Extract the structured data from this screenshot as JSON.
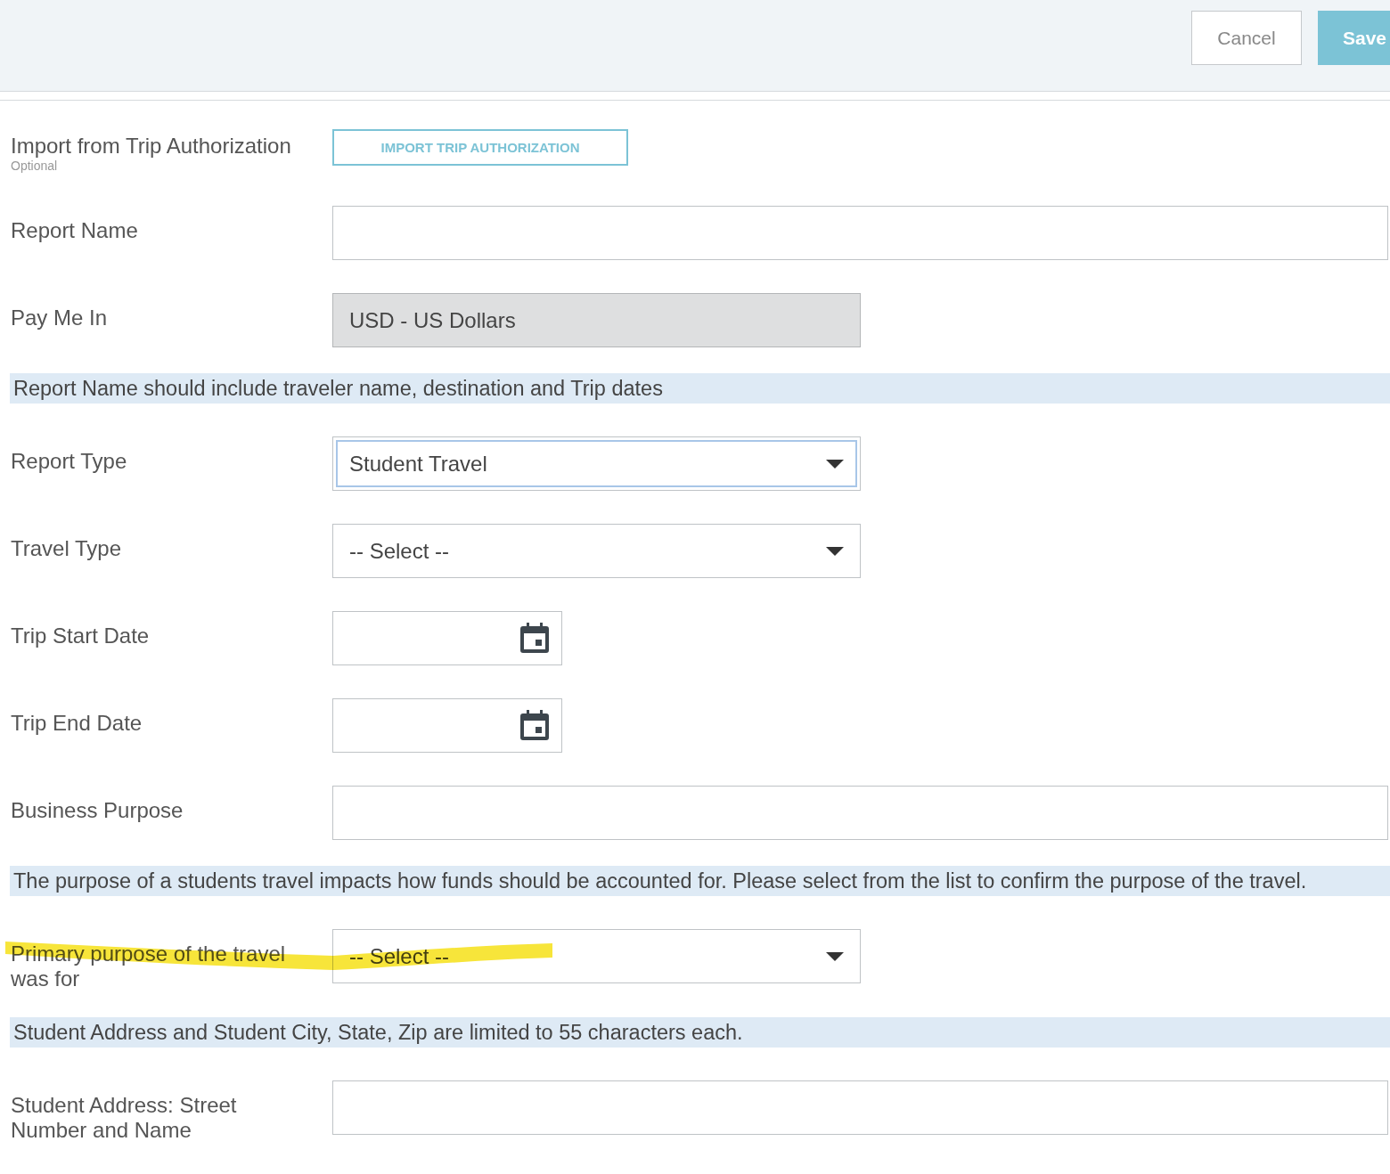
{
  "header": {
    "buttons": [
      {
        "label": "Cancel",
        "kind": "secondary"
      },
      {
        "label": "Save",
        "kind": "primary"
      }
    ]
  },
  "rows": [
    {
      "kind": "button",
      "label": "Import from Trip Authorization",
      "hint": "Optional",
      "button": "IMPORT TRIP AUTHORIZATION"
    },
    {
      "kind": "text",
      "label": "Report Name"
    },
    {
      "kind": "readonly",
      "label": "Pay Me In",
      "value": "USD - US Dollars"
    },
    {
      "kind": "note",
      "text": "Report Name should include traveler name, destination and Trip dates"
    },
    {
      "kind": "select",
      "label": "Report Type",
      "value": "Student Travel",
      "focused": true
    },
    {
      "kind": "select",
      "label": "Travel Type",
      "value": "-- Select --",
      "focused": false
    },
    {
      "kind": "date",
      "label": "Trip Start Date"
    },
    {
      "kind": "date",
      "label": "Trip End Date"
    },
    {
      "kind": "text",
      "label": "Business Purpose"
    },
    {
      "kind": "note",
      "text": "The purpose of a students travel impacts how funds should be accounted for. Please select from the list to confirm the purpose of the travel."
    },
    {
      "kind": "select",
      "label": "Primary purpose of the travel was for",
      "value": "-- Select --",
      "focused": false,
      "highlighted": true
    },
    {
      "kind": "note",
      "text": "Student Address and Student City, State, Zip are limited to 55 characters each."
    },
    {
      "kind": "text",
      "label": "Student Address: Street Number and Name"
    }
  ]
}
